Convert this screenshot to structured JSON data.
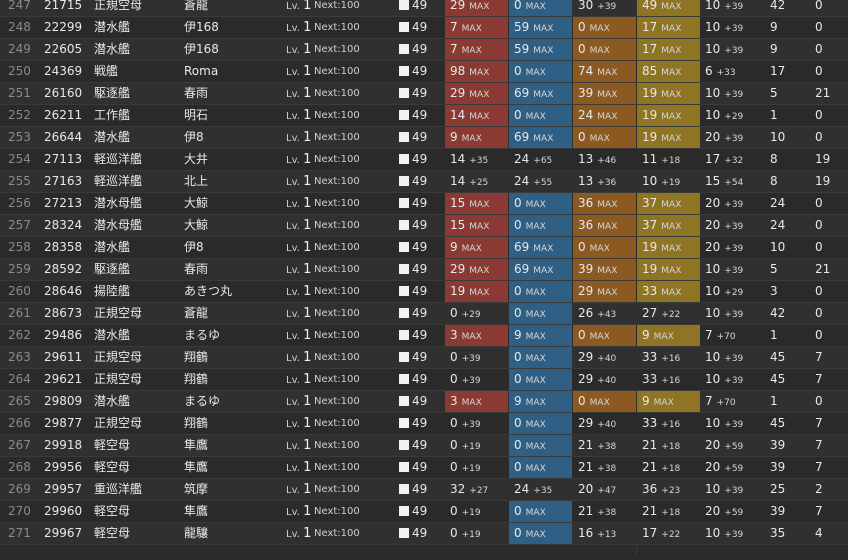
{
  "condition_label": "49",
  "rows": [
    {
      "idx": "247",
      "id": "21715",
      "type": "正規空母",
      "name": "蒼龍",
      "lv": "1",
      "next": "Next:100",
      "fp": "29",
      "fp_a": "MAX",
      "fp_max": true,
      "tp": "0",
      "tp_a": "MAX",
      "tp_max": true,
      "aa": "30",
      "aa_a": "+39",
      "aa_max": false,
      "ar": "49",
      "ar_a": "MAX",
      "ar_max": true,
      "luck": "10",
      "luck_a": "+39",
      "slot": "42",
      "last": "0"
    },
    {
      "idx": "248",
      "id": "22299",
      "type": "潜水艦",
      "name": "伊168",
      "lv": "1",
      "next": "Next:100",
      "fp": "7",
      "fp_a": "MAX",
      "fp_max": true,
      "tp": "59",
      "tp_a": "MAX",
      "tp_max": true,
      "aa": "0",
      "aa_a": "MAX",
      "aa_max": true,
      "ar": "17",
      "ar_a": "MAX",
      "ar_max": true,
      "luck": "10",
      "luck_a": "+39",
      "slot": "9",
      "last": "0"
    },
    {
      "idx": "249",
      "id": "22605",
      "type": "潜水艦",
      "name": "伊168",
      "lv": "1",
      "next": "Next:100",
      "fp": "7",
      "fp_a": "MAX",
      "fp_max": true,
      "tp": "59",
      "tp_a": "MAX",
      "tp_max": true,
      "aa": "0",
      "aa_a": "MAX",
      "aa_max": true,
      "ar": "17",
      "ar_a": "MAX",
      "ar_max": true,
      "luck": "10",
      "luck_a": "+39",
      "slot": "9",
      "last": "0"
    },
    {
      "idx": "250",
      "id": "24369",
      "type": "戦艦",
      "name": "Roma",
      "lv": "1",
      "next": "Next:100",
      "fp": "98",
      "fp_a": "MAX",
      "fp_max": true,
      "tp": "0",
      "tp_a": "MAX",
      "tp_max": true,
      "aa": "74",
      "aa_a": "MAX",
      "aa_max": true,
      "ar": "85",
      "ar_a": "MAX",
      "ar_max": true,
      "luck": "6",
      "luck_a": "+33",
      "slot": "17",
      "last": "0"
    },
    {
      "idx": "251",
      "id": "26160",
      "type": "駆逐艦",
      "name": "春雨",
      "lv": "1",
      "next": "Next:100",
      "fp": "29",
      "fp_a": "MAX",
      "fp_max": true,
      "tp": "69",
      "tp_a": "MAX",
      "tp_max": true,
      "aa": "39",
      "aa_a": "MAX",
      "aa_max": true,
      "ar": "19",
      "ar_a": "MAX",
      "ar_max": true,
      "luck": "10",
      "luck_a": "+39",
      "slot": "5",
      "last": "21"
    },
    {
      "idx": "252",
      "id": "26211",
      "type": "工作艦",
      "name": "明石",
      "lv": "1",
      "next": "Next:100",
      "fp": "14",
      "fp_a": "MAX",
      "fp_max": true,
      "tp": "0",
      "tp_a": "MAX",
      "tp_max": true,
      "aa": "24",
      "aa_a": "MAX",
      "aa_max": true,
      "ar": "19",
      "ar_a": "MAX",
      "ar_max": true,
      "luck": "10",
      "luck_a": "+29",
      "slot": "1",
      "last": "0"
    },
    {
      "idx": "253",
      "id": "26644",
      "type": "潜水艦",
      "name": "伊8",
      "lv": "1",
      "next": "Next:100",
      "fp": "9",
      "fp_a": "MAX",
      "fp_max": true,
      "tp": "69",
      "tp_a": "MAX",
      "tp_max": true,
      "aa": "0",
      "aa_a": "MAX",
      "aa_max": true,
      "ar": "19",
      "ar_a": "MAX",
      "ar_max": true,
      "luck": "20",
      "luck_a": "+39",
      "slot": "10",
      "last": "0"
    },
    {
      "idx": "254",
      "id": "27113",
      "type": "軽巡洋艦",
      "name": "大井",
      "lv": "1",
      "next": "Next:100",
      "fp": "14",
      "fp_a": "+35",
      "fp_max": false,
      "tp": "24",
      "tp_a": "+65",
      "tp_max": false,
      "aa": "13",
      "aa_a": "+46",
      "aa_max": false,
      "ar": "11",
      "ar_a": "+18",
      "ar_max": false,
      "luck": "17",
      "luck_a": "+32",
      "slot": "8",
      "last": "19"
    },
    {
      "idx": "255",
      "id": "27163",
      "type": "軽巡洋艦",
      "name": "北上",
      "lv": "1",
      "next": "Next:100",
      "fp": "14",
      "fp_a": "+25",
      "fp_max": false,
      "tp": "24",
      "tp_a": "+55",
      "tp_max": false,
      "aa": "13",
      "aa_a": "+36",
      "aa_max": false,
      "ar": "10",
      "ar_a": "+19",
      "ar_max": false,
      "luck": "15",
      "luck_a": "+54",
      "slot": "8",
      "last": "19"
    },
    {
      "idx": "256",
      "id": "27213",
      "type": "潜水母艦",
      "name": "大鯨",
      "lv": "1",
      "next": "Next:100",
      "fp": "15",
      "fp_a": "MAX",
      "fp_max": true,
      "tp": "0",
      "tp_a": "MAX",
      "tp_max": true,
      "aa": "36",
      "aa_a": "MAX",
      "aa_max": true,
      "ar": "37",
      "ar_a": "MAX",
      "ar_max": true,
      "luck": "20",
      "luck_a": "+39",
      "slot": "24",
      "last": "0"
    },
    {
      "idx": "257",
      "id": "28324",
      "type": "潜水母艦",
      "name": "大鯨",
      "lv": "1",
      "next": "Next:100",
      "fp": "15",
      "fp_a": "MAX",
      "fp_max": true,
      "tp": "0",
      "tp_a": "MAX",
      "tp_max": true,
      "aa": "36",
      "aa_a": "MAX",
      "aa_max": true,
      "ar": "37",
      "ar_a": "MAX",
      "ar_max": true,
      "luck": "20",
      "luck_a": "+39",
      "slot": "24",
      "last": "0"
    },
    {
      "idx": "258",
      "id": "28358",
      "type": "潜水艦",
      "name": "伊8",
      "lv": "1",
      "next": "Next:100",
      "fp": "9",
      "fp_a": "MAX",
      "fp_max": true,
      "tp": "69",
      "tp_a": "MAX",
      "tp_max": true,
      "aa": "0",
      "aa_a": "MAX",
      "aa_max": true,
      "ar": "19",
      "ar_a": "MAX",
      "ar_max": true,
      "luck": "20",
      "luck_a": "+39",
      "slot": "10",
      "last": "0"
    },
    {
      "idx": "259",
      "id": "28592",
      "type": "駆逐艦",
      "name": "春雨",
      "lv": "1",
      "next": "Next:100",
      "fp": "29",
      "fp_a": "MAX",
      "fp_max": true,
      "tp": "69",
      "tp_a": "MAX",
      "tp_max": true,
      "aa": "39",
      "aa_a": "MAX",
      "aa_max": true,
      "ar": "19",
      "ar_a": "MAX",
      "ar_max": true,
      "luck": "10",
      "luck_a": "+39",
      "slot": "5",
      "last": "21"
    },
    {
      "idx": "260",
      "id": "28646",
      "type": "揚陸艦",
      "name": "あきつ丸",
      "lv": "1",
      "next": "Next:100",
      "fp": "19",
      "fp_a": "MAX",
      "fp_max": true,
      "tp": "0",
      "tp_a": "MAX",
      "tp_max": true,
      "aa": "29",
      "aa_a": "MAX",
      "aa_max": true,
      "ar": "33",
      "ar_a": "MAX",
      "ar_max": true,
      "luck": "10",
      "luck_a": "+29",
      "slot": "3",
      "last": "0"
    },
    {
      "idx": "261",
      "id": "28673",
      "type": "正規空母",
      "name": "蒼龍",
      "lv": "1",
      "next": "Next:100",
      "fp": "0",
      "fp_a": "+29",
      "fp_max": false,
      "tp": "0",
      "tp_a": "MAX",
      "tp_max": true,
      "aa": "26",
      "aa_a": "+43",
      "aa_max": false,
      "ar": "27",
      "ar_a": "+22",
      "ar_max": false,
      "luck": "10",
      "luck_a": "+39",
      "slot": "42",
      "last": "0"
    },
    {
      "idx": "262",
      "id": "29486",
      "type": "潜水艦",
      "name": "まるゆ",
      "lv": "1",
      "next": "Next:100",
      "fp": "3",
      "fp_a": "MAX",
      "fp_max": true,
      "tp": "9",
      "tp_a": "MAX",
      "tp_max": true,
      "aa": "0",
      "aa_a": "MAX",
      "aa_max": true,
      "ar": "9",
      "ar_a": "MAX",
      "ar_max": true,
      "luck": "7",
      "luck_a": "+70",
      "slot": "1",
      "last": "0"
    },
    {
      "idx": "263",
      "id": "29611",
      "type": "正規空母",
      "name": "翔鶴",
      "lv": "1",
      "next": "Next:100",
      "fp": "0",
      "fp_a": "+39",
      "fp_max": false,
      "tp": "0",
      "tp_a": "MAX",
      "tp_max": true,
      "aa": "29",
      "aa_a": "+40",
      "aa_max": false,
      "ar": "33",
      "ar_a": "+16",
      "ar_max": false,
      "luck": "10",
      "luck_a": "+39",
      "slot": "45",
      "last": "7"
    },
    {
      "idx": "264",
      "id": "29621",
      "type": "正規空母",
      "name": "翔鶴",
      "lv": "1",
      "next": "Next:100",
      "fp": "0",
      "fp_a": "+39",
      "fp_max": false,
      "tp": "0",
      "tp_a": "MAX",
      "tp_max": true,
      "aa": "29",
      "aa_a": "+40",
      "aa_max": false,
      "ar": "33",
      "ar_a": "+16",
      "ar_max": false,
      "luck": "10",
      "luck_a": "+39",
      "slot": "45",
      "last": "7"
    },
    {
      "idx": "265",
      "id": "29809",
      "type": "潜水艦",
      "name": "まるゆ",
      "lv": "1",
      "next": "Next:100",
      "fp": "3",
      "fp_a": "MAX",
      "fp_max": true,
      "tp": "9",
      "tp_a": "MAX",
      "tp_max": true,
      "aa": "0",
      "aa_a": "MAX",
      "aa_max": true,
      "ar": "9",
      "ar_a": "MAX",
      "ar_max": true,
      "luck": "7",
      "luck_a": "+70",
      "slot": "1",
      "last": "0"
    },
    {
      "idx": "266",
      "id": "29877",
      "type": "正規空母",
      "name": "翔鶴",
      "lv": "1",
      "next": "Next:100",
      "fp": "0",
      "fp_a": "+39",
      "fp_max": false,
      "tp": "0",
      "tp_a": "MAX",
      "tp_max": true,
      "aa": "29",
      "aa_a": "+40",
      "aa_max": false,
      "ar": "33",
      "ar_a": "+16",
      "ar_max": false,
      "luck": "10",
      "luck_a": "+39",
      "slot": "45",
      "last": "7"
    },
    {
      "idx": "267",
      "id": "29918",
      "type": "軽空母",
      "name": "隼鷹",
      "lv": "1",
      "next": "Next:100",
      "fp": "0",
      "fp_a": "+19",
      "fp_max": false,
      "tp": "0",
      "tp_a": "MAX",
      "tp_max": true,
      "aa": "21",
      "aa_a": "+38",
      "aa_max": false,
      "ar": "21",
      "ar_a": "+18",
      "ar_max": false,
      "luck": "20",
      "luck_a": "+59",
      "slot": "39",
      "last": "7"
    },
    {
      "idx": "268",
      "id": "29956",
      "type": "軽空母",
      "name": "隼鷹",
      "lv": "1",
      "next": "Next:100",
      "fp": "0",
      "fp_a": "+19",
      "fp_max": false,
      "tp": "0",
      "tp_a": "MAX",
      "tp_max": true,
      "aa": "21",
      "aa_a": "+38",
      "aa_max": false,
      "ar": "21",
      "ar_a": "+18",
      "ar_max": false,
      "luck": "20",
      "luck_a": "+59",
      "slot": "39",
      "last": "7"
    },
    {
      "idx": "269",
      "id": "29957",
      "type": "重巡洋艦",
      "name": "筑摩",
      "lv": "1",
      "next": "Next:100",
      "fp": "32",
      "fp_a": "+27",
      "fp_max": false,
      "tp": "24",
      "tp_a": "+35",
      "tp_max": false,
      "aa": "20",
      "aa_a": "+47",
      "aa_max": false,
      "ar": "36",
      "ar_a": "+23",
      "ar_max": false,
      "luck": "10",
      "luck_a": "+39",
      "slot": "25",
      "last": "2"
    },
    {
      "idx": "270",
      "id": "29960",
      "type": "軽空母",
      "name": "隼鷹",
      "lv": "1",
      "next": "Next:100",
      "fp": "0",
      "fp_a": "+19",
      "fp_max": false,
      "tp": "0",
      "tp_a": "MAX",
      "tp_max": true,
      "aa": "21",
      "aa_a": "+38",
      "aa_max": false,
      "ar": "21",
      "ar_a": "+18",
      "ar_max": false,
      "luck": "20",
      "luck_a": "+59",
      "slot": "39",
      "last": "7"
    },
    {
      "idx": "271",
      "id": "29967",
      "type": "軽空母",
      "name": "龍驤",
      "lv": "1",
      "next": "Next:100",
      "fp": "0",
      "fp_a": "+19",
      "fp_max": false,
      "tp": "0",
      "tp_a": "MAX",
      "tp_max": true,
      "aa": "16",
      "aa_a": "+13",
      "aa_max": false,
      "ar": "17",
      "ar_a": "+22",
      "ar_max": false,
      "luck": "10",
      "luck_a": "+39",
      "slot": "35",
      "last": "4"
    }
  ]
}
